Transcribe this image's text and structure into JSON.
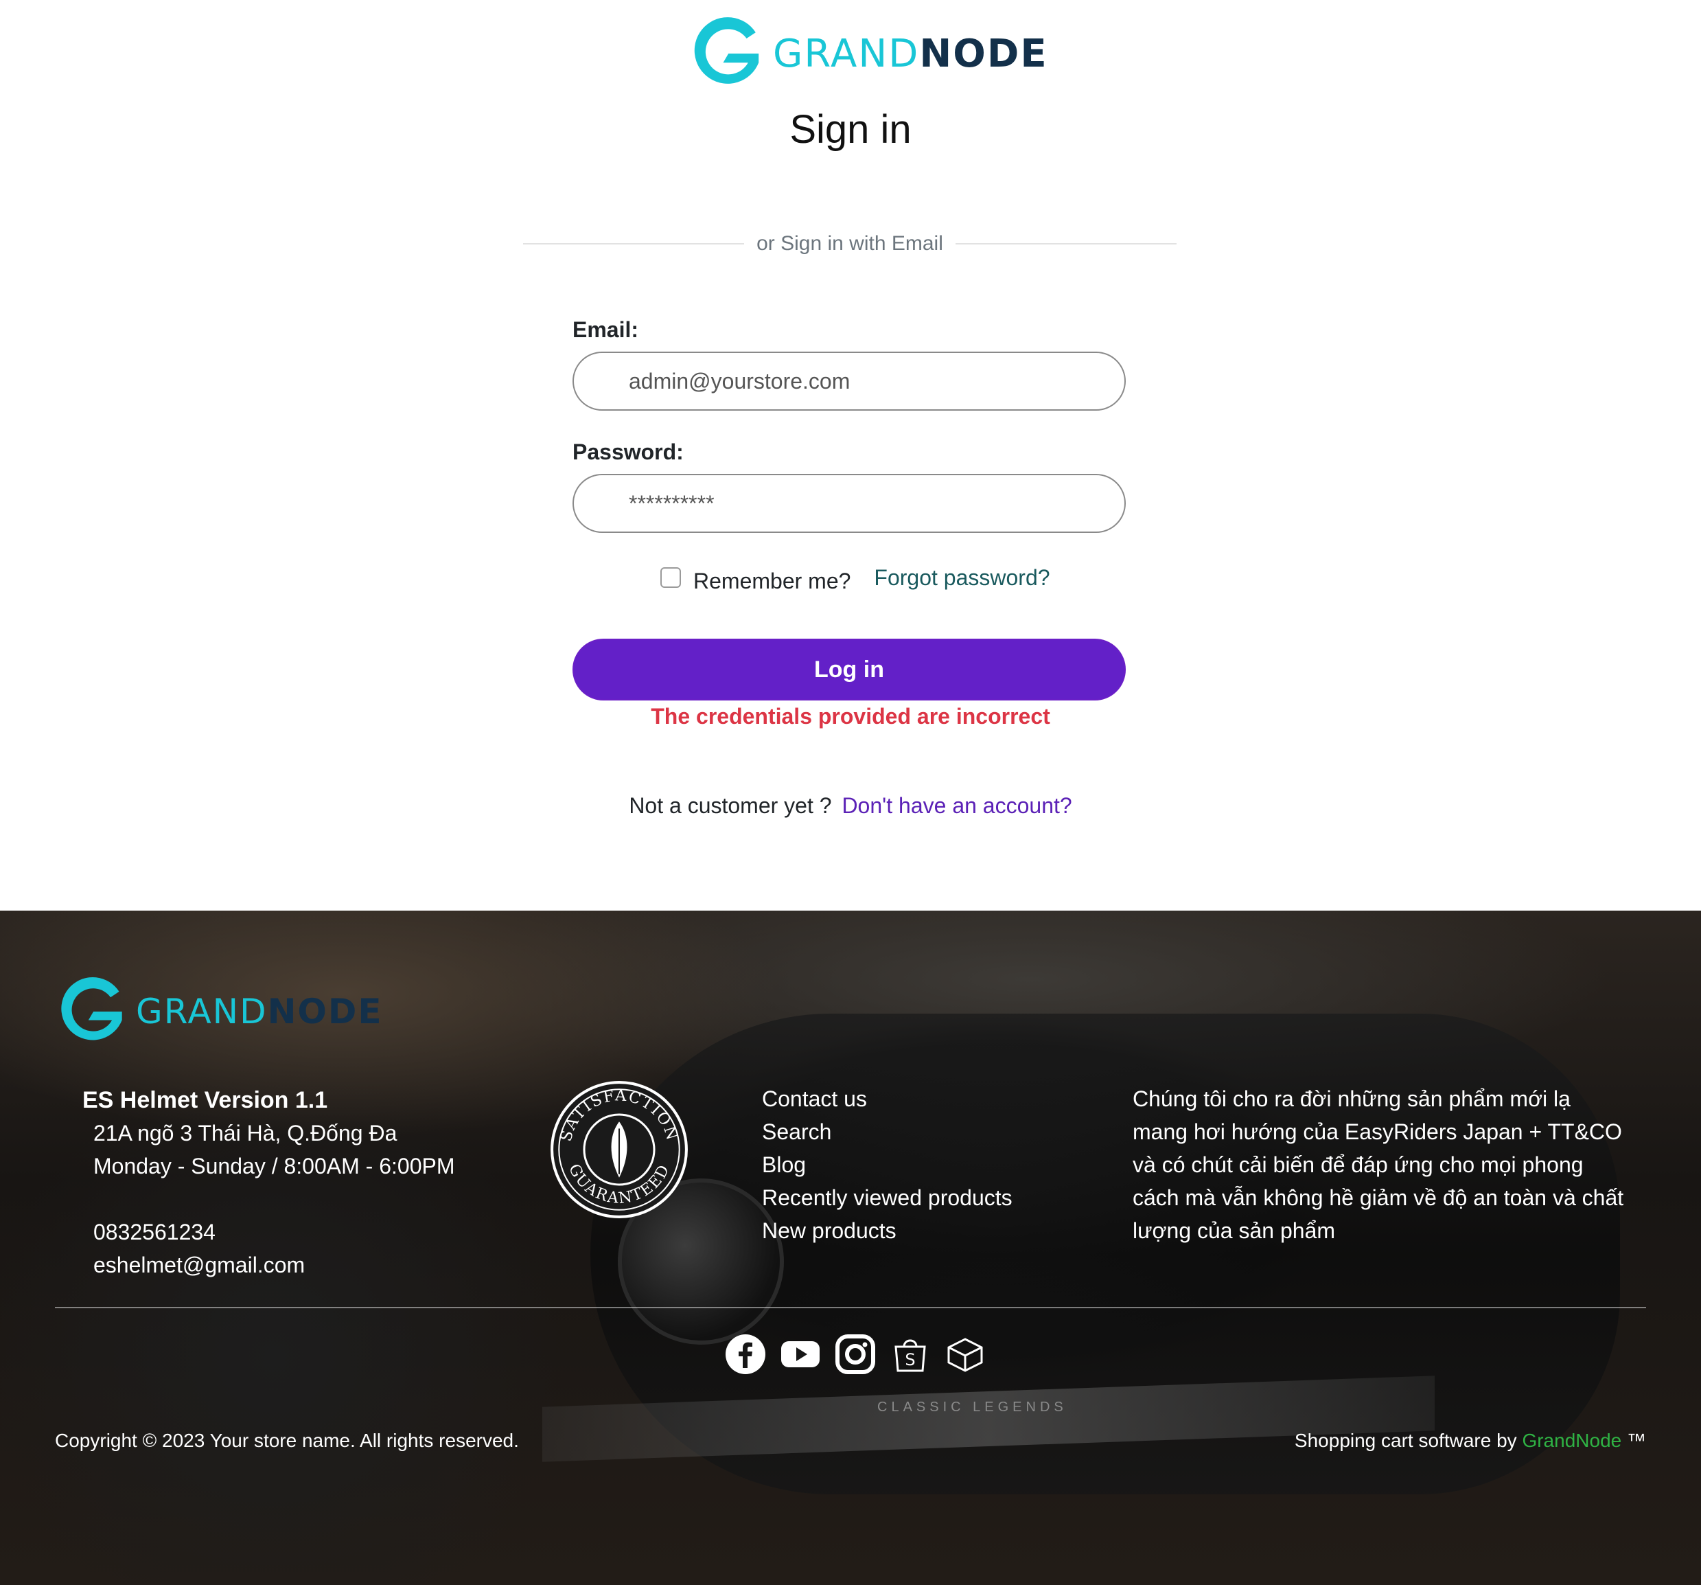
{
  "brand": {
    "grand": "GRAND",
    "node": "NODE",
    "primary": "#19c6d6",
    "dark": "#13304a"
  },
  "page": {
    "title": "Sign in",
    "divider_text": "or Sign in with Email"
  },
  "form": {
    "email_label": "Email:",
    "email_placeholder": "admin@yourstore.com",
    "password_label": "Password:",
    "password_placeholder": "**********",
    "remember_label": "Remember me?",
    "remember_checked": false,
    "forgot_link": "Forgot password?",
    "login_button": "Log in",
    "error": "The credentials provided are incorrect",
    "register_prompt": "Not a customer yet ?",
    "register_link": "Don't have an account?",
    "button_color": "#6320c8",
    "error_color": "#dc3545"
  },
  "footer": {
    "store_name": "ES Helmet Version 1.1",
    "address": "21A ngõ 3 Thái Hà, Q.Đống Đa",
    "hours": "Monday - Sunday / 8:00AM - 6:00PM",
    "phone": "0832561234",
    "email": "eshelmet@gmail.com",
    "seal_top": "SATISFACTION",
    "seal_bottom": "GUARANTEED",
    "links": [
      "Contact us",
      "Search",
      "Blog",
      "Recently viewed products",
      "New products"
    ],
    "about": "Chúng tôi cho ra đời những sản phẩm mới lạ mang hơi hướng của EasyRiders Japan + TT&CO và có chút cải biến để đáp ứng cho mọi phong cách mà vẫn không hề giảm về độ an toàn và chất lượng của sản phẩm",
    "social_icons": [
      "facebook-icon",
      "youtube-icon",
      "instagram-icon",
      "shopee-icon",
      "package-icon"
    ],
    "copyright": "Copyright © 2023 Your store name. All rights reserved.",
    "powered_prefix": "Shopping cart software by",
    "powered_link": "GrandNode",
    "powered_suffix": "™",
    "background_text": "CLASSIC LEGENDS"
  }
}
